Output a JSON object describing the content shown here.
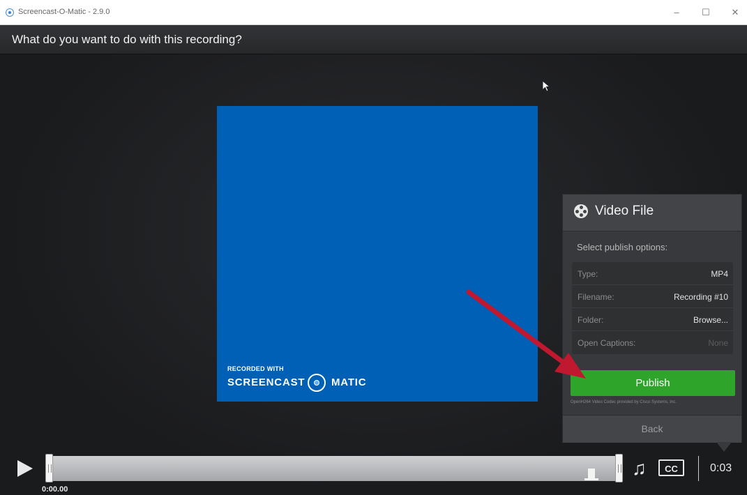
{
  "window": {
    "title": "Screencast-O-Matic - 2.9.0",
    "minimize": "–",
    "maximize": "☐",
    "close": "✕"
  },
  "header": {
    "question": "What do you want to do with this recording?"
  },
  "video": {
    "watermark_small": "RECORDED WITH",
    "watermark_left": "SCREENCAST",
    "watermark_right": "MATIC",
    "background_color": "#0060b6"
  },
  "panel": {
    "title": "Video File",
    "subtitle": "Select publish options:",
    "options": [
      {
        "label": "Type:",
        "value": "MP4"
      },
      {
        "label": "Filename:",
        "value": "Recording #10"
      },
      {
        "label": "Folder:",
        "value": "Browse..."
      },
      {
        "label": "Open Captions:",
        "value": "None"
      }
    ],
    "publish_label": "Publish",
    "codec_note": "OpenH264 Video Codec provided by Cisco Systems, Inc.",
    "back_label": "Back",
    "publish_color": "#2ea52a"
  },
  "player": {
    "current_time": "0:00.00",
    "duration": "0:03",
    "cc_label": "CC",
    "note_glyph": "♫"
  },
  "annotation": {
    "arrow_color": "#c0182f"
  }
}
